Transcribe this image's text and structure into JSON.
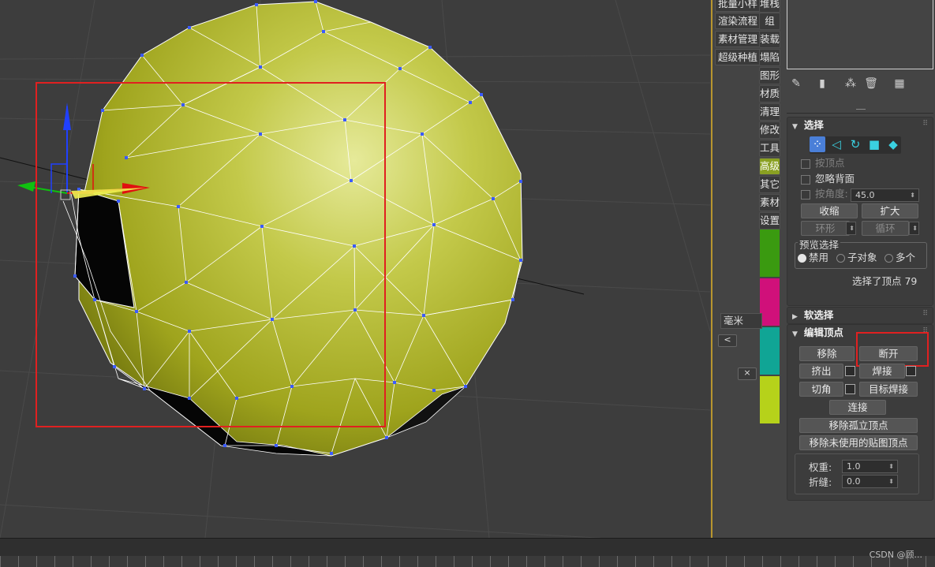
{
  "dock": {
    "left_items": [
      "批量小样",
      "渲染流程",
      "素材管理",
      "超级种植"
    ],
    "right_items": [
      "堆栈",
      "组",
      "装载",
      "塌陷",
      "图形",
      "材质",
      "清理",
      "修改",
      "工具",
      "高级",
      "其它",
      "素材",
      "设置"
    ],
    "active_item": "高级",
    "swatches": [
      "#3a9a10",
      "#d0107a",
      "#10a595",
      "#b6d21a"
    ],
    "unit": "毫米",
    "back_label": "<",
    "close_label": "×"
  },
  "toolbar_icons": [
    "pin-icon",
    "modifier-stack-icon",
    "show-end-result-icon",
    "remove-modifier-icon",
    "configure-sets-icon"
  ],
  "selection": {
    "title": "选择",
    "by_vertex": "按顶点",
    "ignore_backfacing": "忽略背面",
    "by_angle": "按角度:",
    "angle_value": "45.0",
    "shrink": "收缩",
    "grow": "扩大",
    "ring": "环形",
    "loop": "循环",
    "preview_title": "预览选择",
    "preview_options": [
      "禁用",
      "子对象",
      "多个"
    ],
    "preview_selected": "禁用",
    "status": "选择了顶点 79"
  },
  "soft_selection": {
    "title": "软选择"
  },
  "edit_vertices": {
    "title": "编辑顶点",
    "remove": "移除",
    "break": "断开",
    "extrude": "挤出",
    "weld": "焊接",
    "chamfer": "切角",
    "target_weld": "目标焊接",
    "connect": "连接",
    "remove_isolated": "移除孤立顶点",
    "remove_unused_map": "移除未使用的贴图顶点",
    "weight_label": "权重:",
    "weight_value": "1.0",
    "crease_label": "折缝:",
    "crease_value": "0.0"
  },
  "watermark": "CSDN @顾..."
}
